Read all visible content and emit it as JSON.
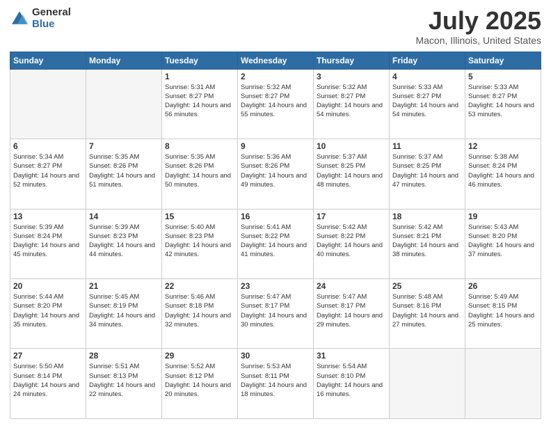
{
  "header": {
    "logo_general": "General",
    "logo_blue": "Blue",
    "title": "July 2025",
    "location": "Macon, Illinois, United States"
  },
  "days_of_week": [
    "Sunday",
    "Monday",
    "Tuesday",
    "Wednesday",
    "Thursday",
    "Friday",
    "Saturday"
  ],
  "weeks": [
    [
      {
        "day": "",
        "empty": true
      },
      {
        "day": "",
        "empty": true
      },
      {
        "day": "1",
        "sunrise": "5:31 AM",
        "sunset": "8:27 PM",
        "daylight": "14 hours and 56 minutes."
      },
      {
        "day": "2",
        "sunrise": "5:32 AM",
        "sunset": "8:27 PM",
        "daylight": "14 hours and 55 minutes."
      },
      {
        "day": "3",
        "sunrise": "5:32 AM",
        "sunset": "8:27 PM",
        "daylight": "14 hours and 54 minutes."
      },
      {
        "day": "4",
        "sunrise": "5:33 AM",
        "sunset": "8:27 PM",
        "daylight": "14 hours and 54 minutes."
      },
      {
        "day": "5",
        "sunrise": "5:33 AM",
        "sunset": "8:27 PM",
        "daylight": "14 hours and 53 minutes."
      }
    ],
    [
      {
        "day": "6",
        "sunrise": "5:34 AM",
        "sunset": "8:27 PM",
        "daylight": "14 hours and 52 minutes."
      },
      {
        "day": "7",
        "sunrise": "5:35 AM",
        "sunset": "8:26 PM",
        "daylight": "14 hours and 51 minutes."
      },
      {
        "day": "8",
        "sunrise": "5:35 AM",
        "sunset": "8:26 PM",
        "daylight": "14 hours and 50 minutes."
      },
      {
        "day": "9",
        "sunrise": "5:36 AM",
        "sunset": "8:26 PM",
        "daylight": "14 hours and 49 minutes."
      },
      {
        "day": "10",
        "sunrise": "5:37 AM",
        "sunset": "8:25 PM",
        "daylight": "14 hours and 48 minutes."
      },
      {
        "day": "11",
        "sunrise": "5:37 AM",
        "sunset": "8:25 PM",
        "daylight": "14 hours and 47 minutes."
      },
      {
        "day": "12",
        "sunrise": "5:38 AM",
        "sunset": "8:24 PM",
        "daylight": "14 hours and 46 minutes."
      }
    ],
    [
      {
        "day": "13",
        "sunrise": "5:39 AM",
        "sunset": "8:24 PM",
        "daylight": "14 hours and 45 minutes."
      },
      {
        "day": "14",
        "sunrise": "5:39 AM",
        "sunset": "8:23 PM",
        "daylight": "14 hours and 44 minutes."
      },
      {
        "day": "15",
        "sunrise": "5:40 AM",
        "sunset": "8:23 PM",
        "daylight": "14 hours and 42 minutes."
      },
      {
        "day": "16",
        "sunrise": "5:41 AM",
        "sunset": "8:22 PM",
        "daylight": "14 hours and 41 minutes."
      },
      {
        "day": "17",
        "sunrise": "5:42 AM",
        "sunset": "8:22 PM",
        "daylight": "14 hours and 40 minutes."
      },
      {
        "day": "18",
        "sunrise": "5:42 AM",
        "sunset": "8:21 PM",
        "daylight": "14 hours and 38 minutes."
      },
      {
        "day": "19",
        "sunrise": "5:43 AM",
        "sunset": "8:20 PM",
        "daylight": "14 hours and 37 minutes."
      }
    ],
    [
      {
        "day": "20",
        "sunrise": "5:44 AM",
        "sunset": "8:20 PM",
        "daylight": "14 hours and 35 minutes."
      },
      {
        "day": "21",
        "sunrise": "5:45 AM",
        "sunset": "8:19 PM",
        "daylight": "14 hours and 34 minutes."
      },
      {
        "day": "22",
        "sunrise": "5:46 AM",
        "sunset": "8:18 PM",
        "daylight": "14 hours and 32 minutes."
      },
      {
        "day": "23",
        "sunrise": "5:47 AM",
        "sunset": "8:17 PM",
        "daylight": "14 hours and 30 minutes."
      },
      {
        "day": "24",
        "sunrise": "5:47 AM",
        "sunset": "8:17 PM",
        "daylight": "14 hours and 29 minutes."
      },
      {
        "day": "25",
        "sunrise": "5:48 AM",
        "sunset": "8:16 PM",
        "daylight": "14 hours and 27 minutes."
      },
      {
        "day": "26",
        "sunrise": "5:49 AM",
        "sunset": "8:15 PM",
        "daylight": "14 hours and 25 minutes."
      }
    ],
    [
      {
        "day": "27",
        "sunrise": "5:50 AM",
        "sunset": "8:14 PM",
        "daylight": "14 hours and 24 minutes."
      },
      {
        "day": "28",
        "sunrise": "5:51 AM",
        "sunset": "8:13 PM",
        "daylight": "14 hours and 22 minutes."
      },
      {
        "day": "29",
        "sunrise": "5:52 AM",
        "sunset": "8:12 PM",
        "daylight": "14 hours and 20 minutes."
      },
      {
        "day": "30",
        "sunrise": "5:53 AM",
        "sunset": "8:11 PM",
        "daylight": "14 hours and 18 minutes."
      },
      {
        "day": "31",
        "sunrise": "5:54 AM",
        "sunset": "8:10 PM",
        "daylight": "14 hours and 16 minutes."
      },
      {
        "day": "",
        "empty": true
      },
      {
        "day": "",
        "empty": true
      }
    ]
  ]
}
